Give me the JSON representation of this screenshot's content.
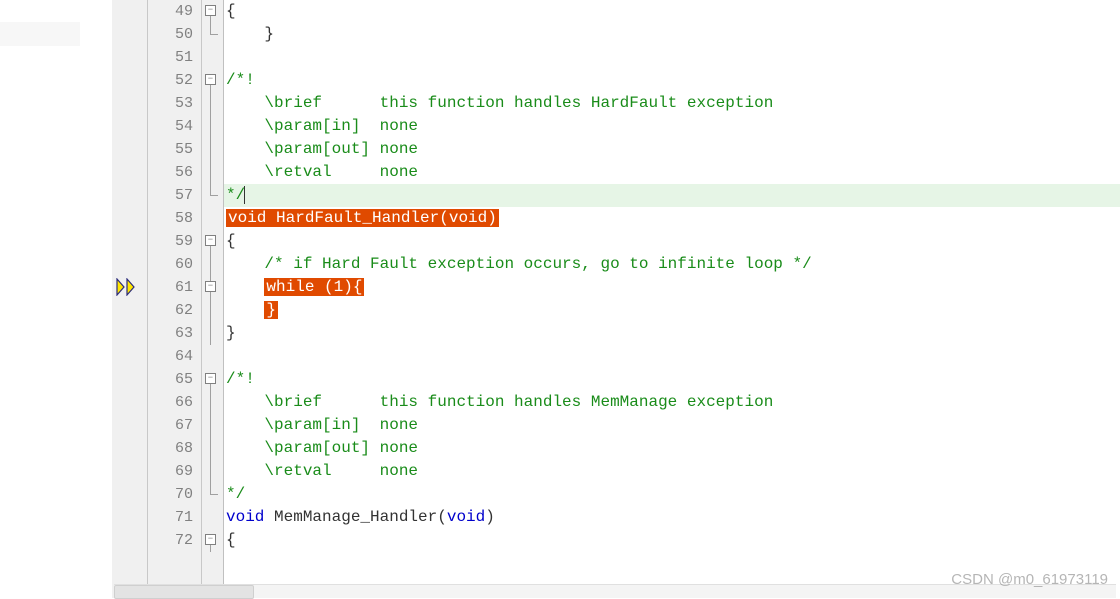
{
  "lines": [
    {
      "num": 49,
      "fold": "box-minus",
      "tokens": [
        {
          "t": "{",
          "cls": "txt"
        }
      ]
    },
    {
      "num": 50,
      "fold": "end-v",
      "tokens": [
        {
          "t": "    }",
          "cls": "txt"
        }
      ]
    },
    {
      "num": 51,
      "fold": "",
      "tokens": []
    },
    {
      "num": 52,
      "fold": "box-minus",
      "tokens": [
        {
          "t": "/*!",
          "cls": "com"
        }
      ]
    },
    {
      "num": 53,
      "fold": "v",
      "tokens": [
        {
          "t": "    \\brief      this function handles HardFault exception",
          "cls": "com"
        }
      ]
    },
    {
      "num": 54,
      "fold": "v",
      "tokens": [
        {
          "t": "    \\param[in]  none",
          "cls": "com"
        }
      ]
    },
    {
      "num": 55,
      "fold": "v",
      "tokens": [
        {
          "t": "    \\param[out] none",
          "cls": "com"
        }
      ]
    },
    {
      "num": 56,
      "fold": "v",
      "tokens": [
        {
          "t": "    \\retval     none",
          "cls": "com"
        }
      ]
    },
    {
      "num": 57,
      "fold": "end",
      "hl": true,
      "tokens": [
        {
          "t": "*/",
          "cls": "com"
        },
        {
          "t": "",
          "cls": "cursor"
        }
      ]
    },
    {
      "num": 58,
      "fold": "",
      "tokens": [
        {
          "t": "void HardFault_Handler(void)",
          "cls": "mark"
        }
      ]
    },
    {
      "num": 59,
      "fold": "box-minus",
      "tokens": [
        {
          "t": "{",
          "cls": "txt"
        }
      ]
    },
    {
      "num": 60,
      "fold": "v",
      "tokens": [
        {
          "t": "    ",
          "cls": "txt"
        },
        {
          "t": "/* if Hard Fault exception occurs, go to infinite loop */",
          "cls": "com"
        }
      ]
    },
    {
      "num": 61,
      "fold": "box-minus-v",
      "bp": true,
      "tokens": [
        {
          "t": "    ",
          "cls": "txt"
        },
        {
          "t": "while (1){",
          "cls": "mark"
        }
      ]
    },
    {
      "num": 62,
      "fold": "v",
      "tokens": [
        {
          "t": "    ",
          "cls": "txt"
        },
        {
          "t": "}",
          "cls": "mark"
        }
      ]
    },
    {
      "num": 63,
      "fold": "v",
      "tokens": [
        {
          "t": "}",
          "cls": "txt"
        }
      ]
    },
    {
      "num": 64,
      "fold": "",
      "tokens": []
    },
    {
      "num": 65,
      "fold": "box-minus",
      "tokens": [
        {
          "t": "/*!",
          "cls": "com"
        }
      ]
    },
    {
      "num": 66,
      "fold": "v",
      "tokens": [
        {
          "t": "    \\brief      this function handles MemManage exception",
          "cls": "com"
        }
      ]
    },
    {
      "num": 67,
      "fold": "v",
      "tokens": [
        {
          "t": "    \\param[in]  none",
          "cls": "com"
        }
      ]
    },
    {
      "num": 68,
      "fold": "v",
      "tokens": [
        {
          "t": "    \\param[out] none",
          "cls": "com"
        }
      ]
    },
    {
      "num": 69,
      "fold": "v",
      "tokens": [
        {
          "t": "    \\retval     none",
          "cls": "com"
        }
      ]
    },
    {
      "num": 70,
      "fold": "end",
      "tokens": [
        {
          "t": "*/",
          "cls": "com"
        }
      ]
    },
    {
      "num": 71,
      "fold": "",
      "tokens": [
        {
          "t": "void",
          "cls": "kw"
        },
        {
          "t": " MemManage_Handler(",
          "cls": "txt"
        },
        {
          "t": "void",
          "cls": "kw"
        },
        {
          "t": ")",
          "cls": "txt"
        }
      ]
    },
    {
      "num": 72,
      "fold": "box-minus",
      "tokens": [
        {
          "t": "{",
          "cls": "txt"
        }
      ]
    }
  ],
  "watermark": "CSDN @m0_61973119"
}
